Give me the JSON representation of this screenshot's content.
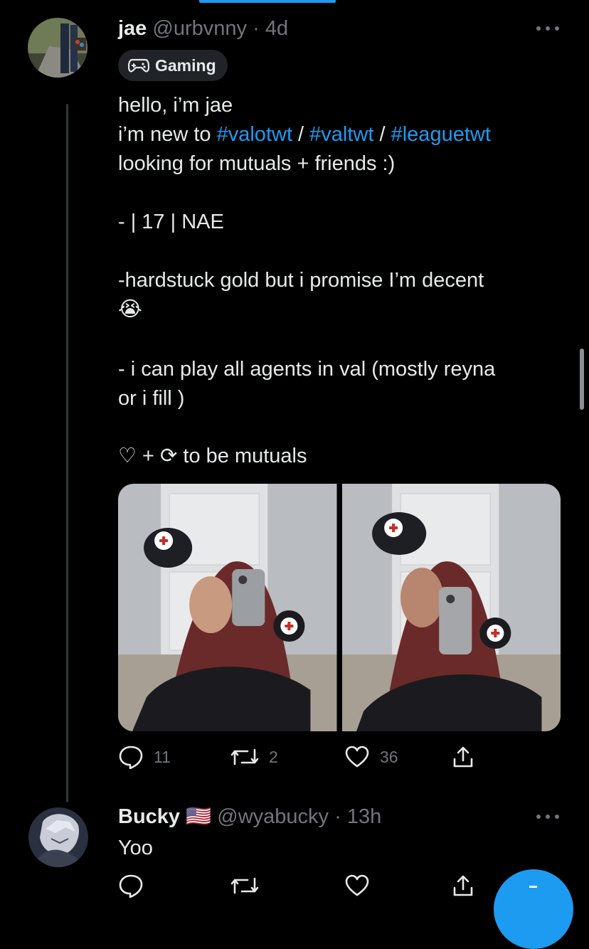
{
  "tweet": {
    "name": "jae",
    "handle": "@urbvnny",
    "dot": "·",
    "time": "4d",
    "topic": "Gaming",
    "lines": {
      "l1": "hello, i’m jae",
      "l2_prefix": "i’m new to ",
      "tag1": "#valotwt",
      "sep1": " / ",
      "tag2": "#valtwt",
      "sep2": " / ",
      "tag3": "#leaguetwt",
      "l3": "looking for mutuals + friends :)",
      "l4": "- | 17 | NAE",
      "l5": "-hardstuck gold but i promise I’m decent",
      "l6_emoji": "😭",
      "l7": "- i can play all agents in val (mostly  reyna",
      "l8": "or i fill )",
      "l9": "♡ + ⟳ to be mutuals"
    },
    "stats": {
      "replies": "11",
      "retweets": "2",
      "likes": "36"
    }
  },
  "reply": {
    "name": "Bucky",
    "flag": "🇺🇸",
    "handle": "@wyabucky",
    "dot": "·",
    "time": "13h",
    "text": "Yoo"
  },
  "icons": {
    "reply": "speech-bubble-icon",
    "retweet": "retweet-icon",
    "like": "heart-icon",
    "share": "share-icon",
    "topic": "gamepad-icon",
    "more": "more-dots-icon"
  },
  "colors": {
    "accent": "#1d9bf0",
    "background": "#000000",
    "text": "#e7e9ea",
    "muted": "#71767b"
  }
}
